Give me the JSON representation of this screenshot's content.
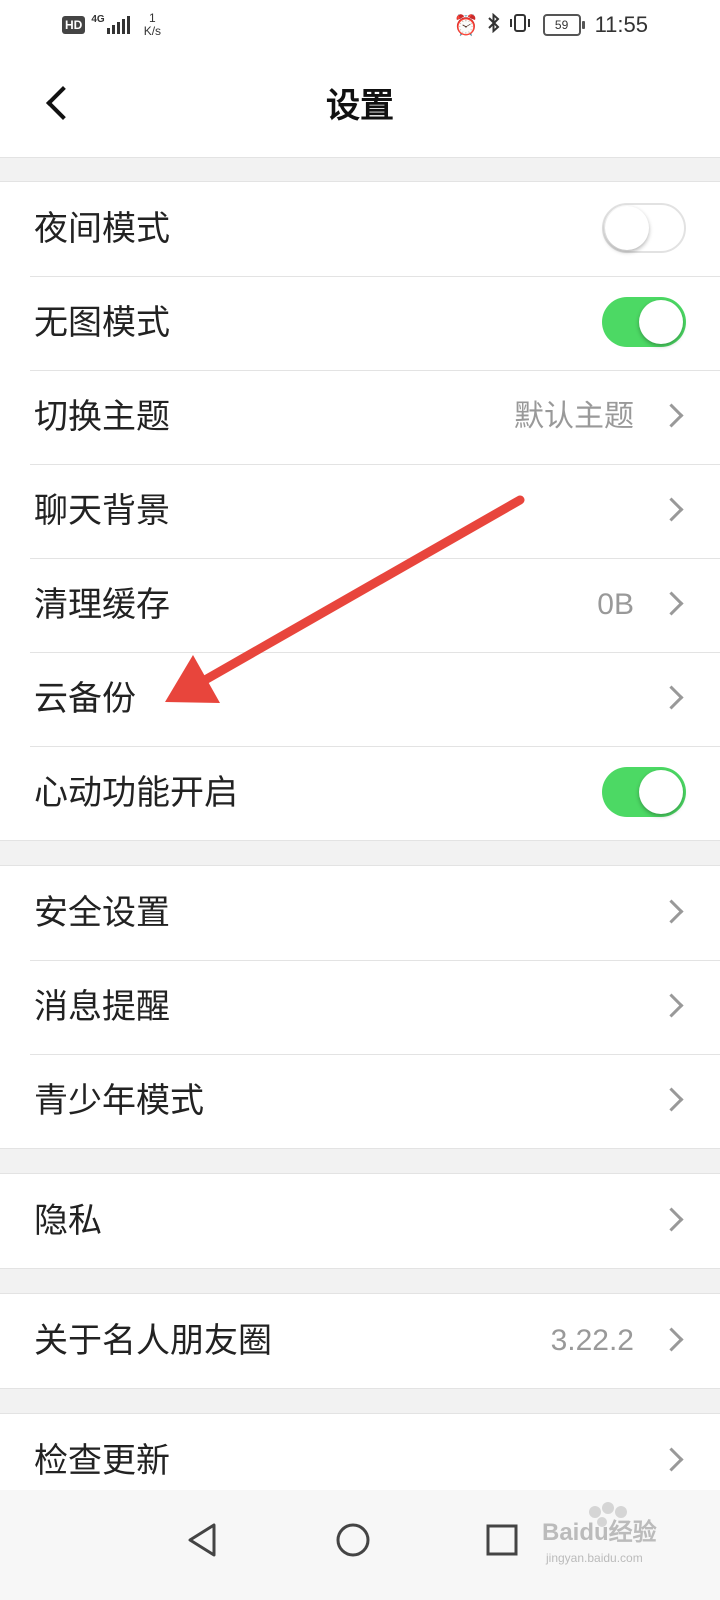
{
  "status_bar": {
    "hd": "HD",
    "network": "4G",
    "speed_value": "1",
    "speed_unit": "K/s",
    "battery": "59",
    "time": "11:55",
    "icons": [
      "alarm-icon",
      "bluetooth-icon",
      "vibrate-icon"
    ]
  },
  "header": {
    "title": "设置",
    "back_icon": "chevron-left-icon"
  },
  "groups": [
    {
      "items": [
        {
          "label": "夜间模式",
          "type": "toggle",
          "on": false
        },
        {
          "label": "无图模式",
          "type": "toggle",
          "on": true
        },
        {
          "label": "切换主题",
          "type": "link",
          "value": "默认主题"
        },
        {
          "label": "聊天背景",
          "type": "link"
        },
        {
          "label": "清理缓存",
          "type": "link",
          "value": "0B"
        },
        {
          "label": "云备份",
          "type": "link"
        },
        {
          "label": "心动功能开启",
          "type": "toggle",
          "on": true
        }
      ]
    },
    {
      "items": [
        {
          "label": "安全设置",
          "type": "link"
        },
        {
          "label": "消息提醒",
          "type": "link"
        },
        {
          "label": "青少年模式",
          "type": "link"
        }
      ]
    },
    {
      "items": [
        {
          "label": "隐私",
          "type": "link"
        }
      ]
    },
    {
      "items": [
        {
          "label": "关于名人朋友圈",
          "type": "link",
          "value": "3.22.2"
        }
      ]
    },
    {
      "items": [
        {
          "label": "检查更新",
          "type": "link"
        }
      ]
    }
  ],
  "annotation": {
    "type": "arrow",
    "color": "#e8453c",
    "points_to": "云备份"
  },
  "system_nav": [
    "back-triangle-icon",
    "home-circle-icon",
    "recents-square-icon"
  ],
  "watermark": {
    "text": "Baidu经验",
    "subtext": "jingyan.baidu.com"
  },
  "colors": {
    "toggle_on": "#4cd964",
    "arrow": "#e8453c",
    "secondary_text": "#999999"
  }
}
